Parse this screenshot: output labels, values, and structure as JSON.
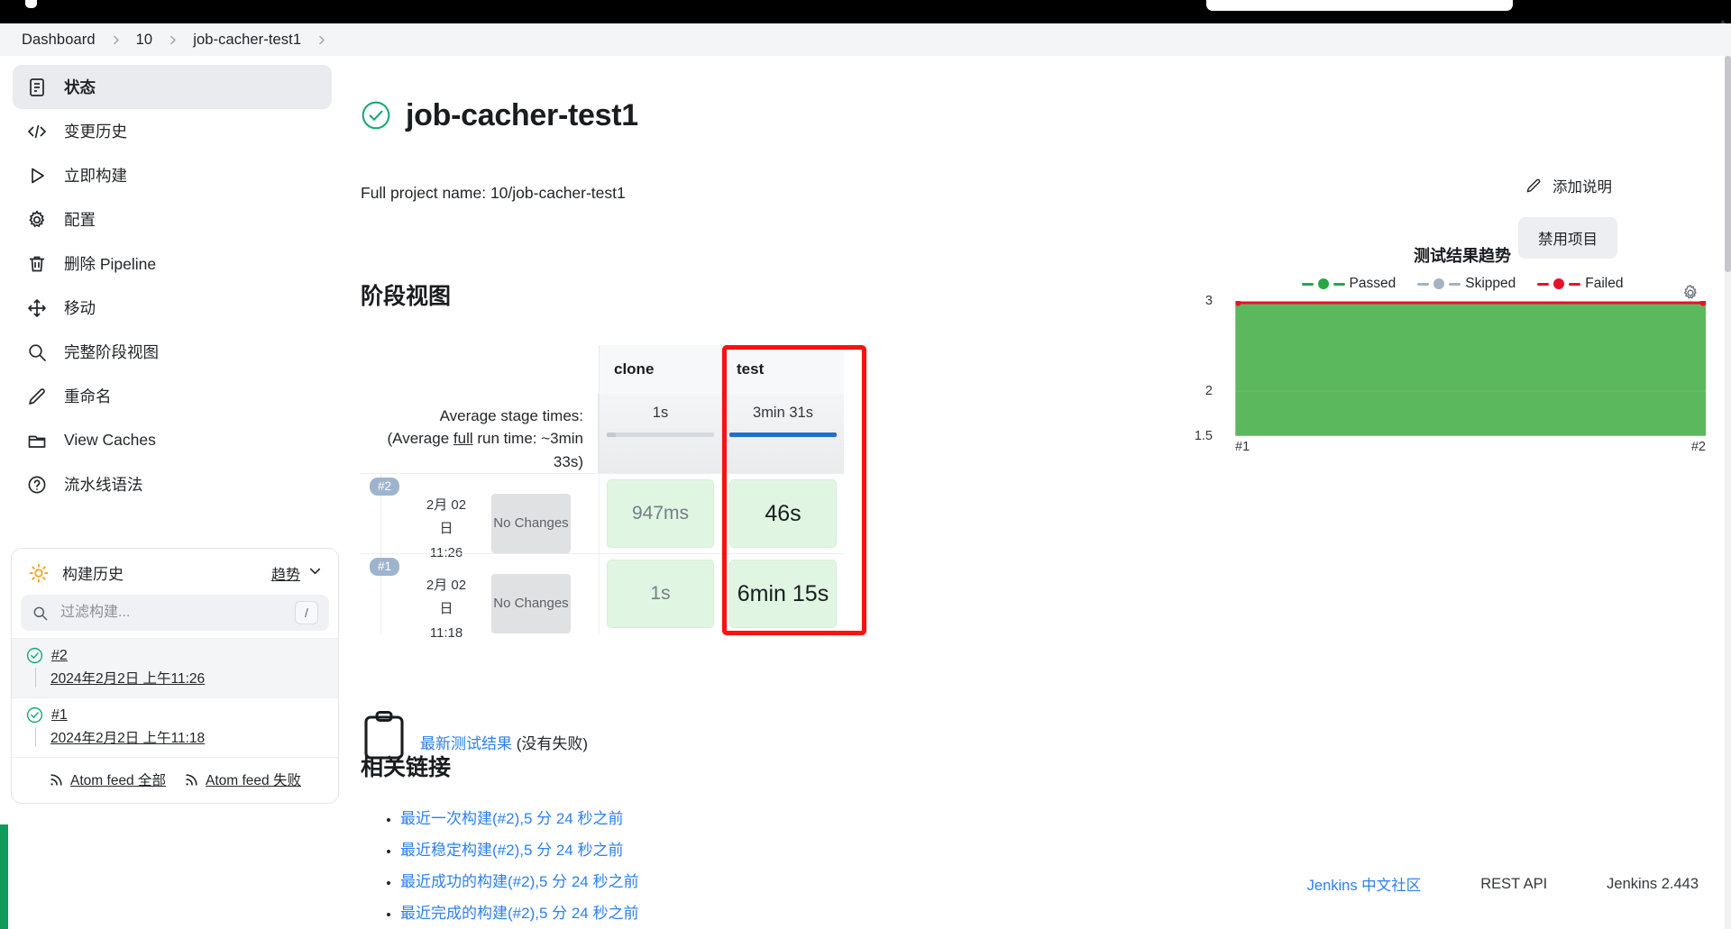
{
  "breadcrumb": [
    {
      "label": "Dashboard"
    },
    {
      "label": "10"
    },
    {
      "label": "job-cacher-test1"
    }
  ],
  "sidebar": {
    "items": [
      {
        "label": "状态",
        "icon": "document-icon",
        "active": true
      },
      {
        "label": "变更历史",
        "icon": "code-icon",
        "active": false
      },
      {
        "label": "立即构建",
        "icon": "play-icon",
        "active": false
      },
      {
        "label": "配置",
        "icon": "gear-icon",
        "active": false
      },
      {
        "label": "删除 Pipeline",
        "icon": "trash-icon",
        "active": false
      },
      {
        "label": "移动",
        "icon": "move-icon",
        "active": false
      },
      {
        "label": "完整阶段视图",
        "icon": "search-icon",
        "active": false
      },
      {
        "label": "重命名",
        "icon": "pencil-icon",
        "active": false
      },
      {
        "label": "View Caches",
        "icon": "folder-icon",
        "active": false
      },
      {
        "label": "流水线语法",
        "icon": "question-icon",
        "active": false
      }
    ]
  },
  "build_history": {
    "title": "构建历史",
    "trend_label": "趋势",
    "filter_placeholder": "过滤构建...",
    "filter_value": "",
    "filter_shortcut": "/",
    "builds": [
      {
        "number": "#2",
        "date": "2024年2月2日 上午11:26",
        "status": "success",
        "selected": true
      },
      {
        "number": "#1",
        "date": "2024年2月2日 上午11:18",
        "status": "success",
        "selected": false
      }
    ],
    "feeds": [
      {
        "label": "Atom feed 全部"
      },
      {
        "label": "Atom feed 失败"
      }
    ]
  },
  "header": {
    "job_name": "job-cacher-test1",
    "status": "success",
    "full_project_name": "Full project name: 10/job-cacher-test1"
  },
  "actions": {
    "add_description": "添加说明",
    "disable_project": "禁用项目"
  },
  "stage_view": {
    "section_title": "阶段视图",
    "avg_label_line1": "Average stage times:",
    "avg_label_line2_pre": "(Average ",
    "avg_label_line2_u": "full",
    "avg_label_line2_post": " run time: ~3min",
    "avg_label_line3": "33s)",
    "columns": [
      {
        "name": "clone",
        "avg": "1s",
        "bar_pct": 8,
        "highlighted": false
      },
      {
        "name": "test",
        "avg": "3min 31s",
        "bar_pct": 100,
        "highlighted": true
      }
    ],
    "runs": [
      {
        "number": "#2",
        "date_line1": "2月 02",
        "date_line2": "日",
        "time": "11:26",
        "changes": "No Changes",
        "cells": [
          {
            "value": "947ms",
            "muted": true
          },
          {
            "value": "46s",
            "muted": false
          }
        ]
      },
      {
        "number": "#1",
        "date_line1": "2月 02",
        "date_line2": "日",
        "time": "11:18",
        "changes": "No Changes",
        "cells": [
          {
            "value": "1s",
            "muted": true
          },
          {
            "value": "6min 15s",
            "muted": false
          }
        ]
      }
    ]
  },
  "latest_test": {
    "link": "最新测试结果",
    "suffix": "(没有失败)"
  },
  "related_links": {
    "title": "相关链接",
    "items": [
      {
        "label": "最近一次构建(#2),5 分 24 秒之前"
      },
      {
        "label": "最近稳定构建(#2),5 分 24 秒之前"
      },
      {
        "label": "最近成功的构建(#2),5 分 24 秒之前"
      },
      {
        "label": "最近完成的构建(#2),5 分 24 秒之前"
      }
    ]
  },
  "chart_data": {
    "type": "area",
    "title": "测试结果趋势",
    "xlabel": "",
    "ylabel": "",
    "x": [
      "#1",
      "#2"
    ],
    "categories": [
      "#1",
      "#2"
    ],
    "series": [
      {
        "name": "Passed",
        "values": [
          3,
          3
        ],
        "color": "#5cb85c"
      },
      {
        "name": "Skipped",
        "values": [
          0,
          0
        ],
        "color": "#a4b3bf"
      },
      {
        "name": "Failed",
        "values": [
          3,
          3
        ],
        "color": "#e8102b"
      }
    ],
    "ylim": [
      1.5,
      3
    ],
    "yticks": [
      3,
      2,
      1.5
    ],
    "ytick_labels": [
      "3",
      "2",
      "1.5"
    ],
    "xtick_labels": [
      "#1",
      "#2"
    ],
    "grid": false,
    "legend_position": "top",
    "legend": [
      "Passed",
      "Skipped",
      "Failed"
    ],
    "settings_icon": "gear-icon"
  },
  "footer": {
    "community_link": "Jenkins 中文社区",
    "rest_api": "REST API",
    "version": "Jenkins 2.443"
  }
}
